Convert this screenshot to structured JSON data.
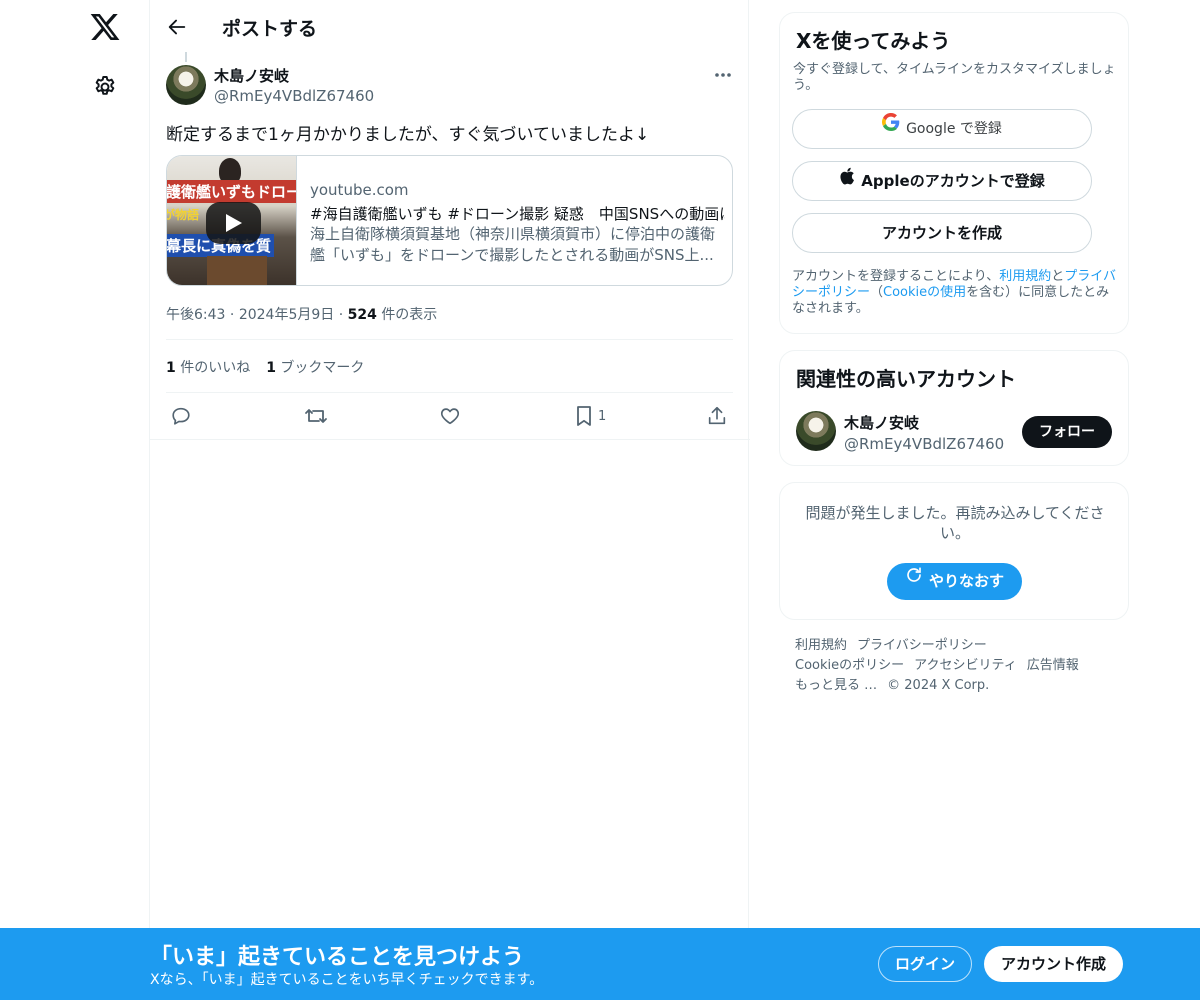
{
  "icons": {
    "logo": "x-logo-icon",
    "settings": "gear-icon",
    "back": "arrow-left-icon",
    "more": "ellipsis-icon",
    "reply": "reply-icon",
    "repost": "repost-icon",
    "like": "heart-icon",
    "bookmark": "bookmark-icon",
    "share": "share-icon",
    "play": "play-icon",
    "google": "google-icon",
    "apple": "apple-icon",
    "refresh": "refresh-icon"
  },
  "colors": {
    "accent": "#1d9bf0",
    "text": "#0f1419",
    "muted": "#536471",
    "border": "#cfd9de"
  },
  "header": {
    "title": "ポストする"
  },
  "post": {
    "author_name": "木島ノ安岐",
    "author_handle": "@RmEy4VBdlZ67460",
    "text": "断定するまで1ヶ月かかりましたが、すぐ気づいていましたよ↓",
    "card": {
      "thumb_caption_1": "護衛艦いずもドロー",
      "thumb_caption_2": "が物語",
      "thumb_caption_3": "幕長に真偽を質",
      "domain": "youtube.com",
      "title": "#海自護衛艦いずも #ドローン撮影 疑惑　中国SNSへの動画は",
      "description": "海上自衛隊横須賀基地（神奈川県横須賀市）に停泊中の護衛艦「いずも」をドローンで撮影したとされる動画がSNS上..."
    },
    "time": "午後6:43",
    "date": "2024年5月9日",
    "dot": "·",
    "views_count": "524",
    "views_label": "件の表示",
    "likes_count": "1",
    "likes_label": "件のいいね",
    "bookmarks_count": "1",
    "bookmarks_label": "ブックマーク",
    "bookmark_action_count": "1"
  },
  "signup_panel": {
    "title": "Xを使ってみよう",
    "subtitle": "今すぐ登録して、タイムラインをカスタマイズしましょう。",
    "google_label": "Google で登録",
    "apple_label": "Appleのアカウントで登録",
    "create_label": "アカウントを作成",
    "legal_1": "アカウントを登録することにより、",
    "legal_terms": "利用規約",
    "legal_and": "と",
    "legal_privacy": "プライバシーポリシー",
    "legal_open": "（",
    "legal_cookie": "Cookieの使用",
    "legal_2": "を含む）に同意したとみなされます。"
  },
  "related": {
    "title": "関連性の高いアカウント",
    "name": "木島ノ安岐",
    "handle": "@RmEy4VBdlZ67460",
    "follow_label": "フォロー"
  },
  "error_panel": {
    "message": "問題が発生しました。再読み込みしてください。",
    "retry_label": "やりなおす"
  },
  "footer": {
    "terms": "利用規約",
    "privacy": "プライバシーポリシー",
    "cookie": "Cookieのポリシー",
    "accessibility": "アクセシビリティ",
    "ads": "広告情報",
    "more": "もっと見る …",
    "copyright": "© 2024 X Corp."
  },
  "banner": {
    "title": "「いま」起きていることを見つけよう",
    "subtitle": "Xなら、「いま」起きていることをいち早くチェックできます。",
    "login_label": "ログイン",
    "signup_label": "アカウント作成"
  }
}
